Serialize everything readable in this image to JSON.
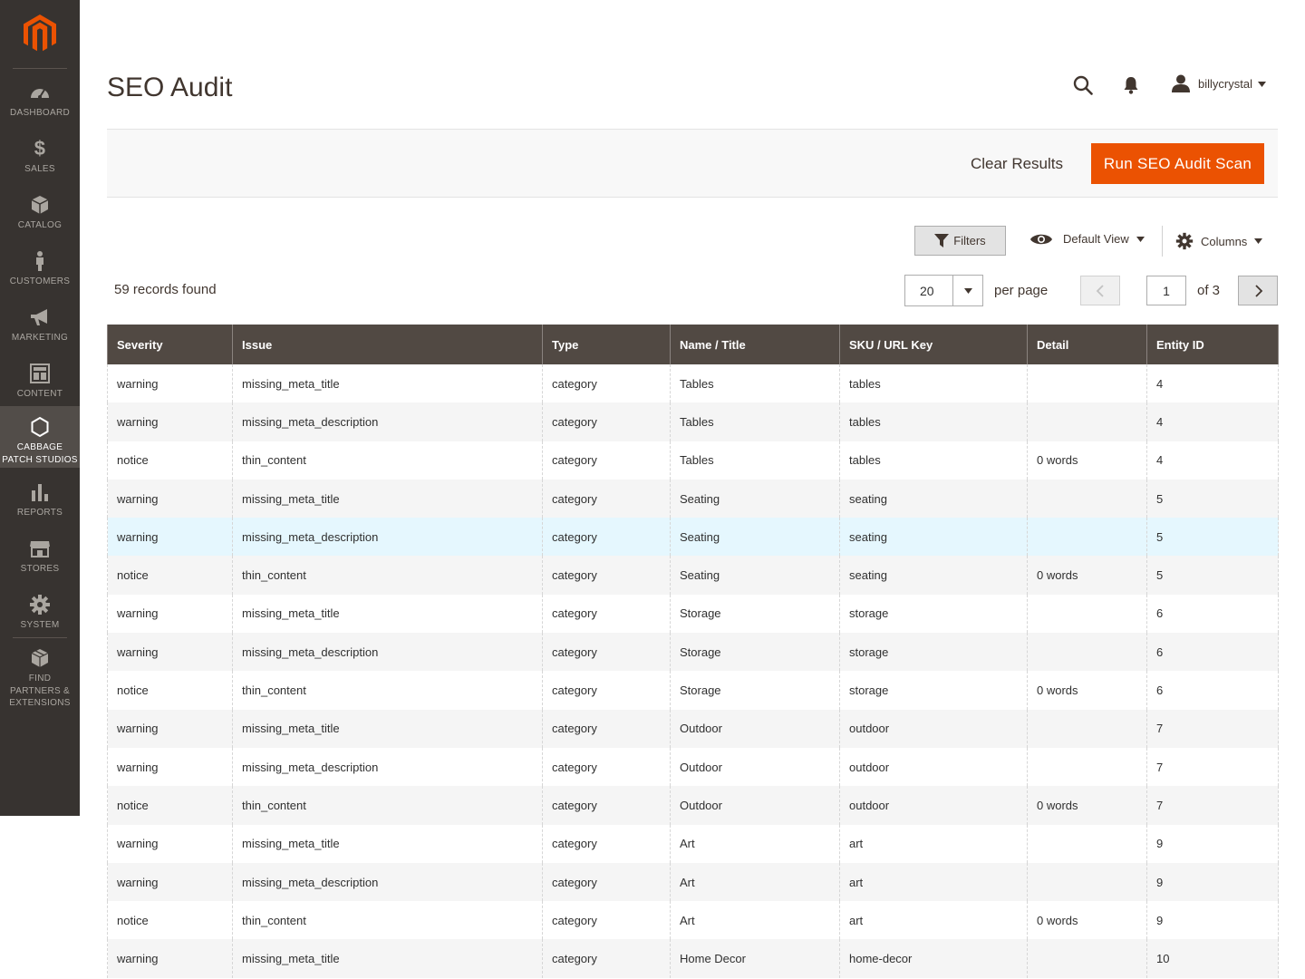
{
  "sidebar": {
    "items": [
      {
        "label": "DASHBOARD",
        "icon": "dashboard-icon"
      },
      {
        "label": "SALES",
        "icon": "dollar-icon"
      },
      {
        "label": "CATALOG",
        "icon": "cube-icon"
      },
      {
        "label": "CUSTOMERS",
        "icon": "person-icon"
      },
      {
        "label": "MARKETING",
        "icon": "megaphone-icon"
      },
      {
        "label": "CONTENT",
        "icon": "layout-icon"
      },
      {
        "label": "CABBAGE PATCH STUDIOS",
        "icon": "hexagon-icon"
      },
      {
        "label": "REPORTS",
        "icon": "bar-chart-icon"
      },
      {
        "label": "STORES",
        "icon": "storefront-icon"
      },
      {
        "label": "SYSTEM",
        "icon": "gear-icon"
      },
      {
        "label": "FIND PARTNERS & EXTENSIONS",
        "icon": "blocks-icon"
      }
    ],
    "active": "CABBAGE PATCH STUDIOS"
  },
  "header": {
    "title": "SEO Audit",
    "user": "billycrystal"
  },
  "actions": {
    "clear": "Clear Results",
    "run": "Run SEO Audit Scan"
  },
  "controls": {
    "filters": "Filters",
    "view": "Default View",
    "columns": "Columns"
  },
  "pagination": {
    "records": "59 records found",
    "per_page_value": "20",
    "per_page_label": "per page",
    "current_page": "1",
    "of": "of 3"
  },
  "colors": {
    "sidebar": "#373330",
    "accent": "#eb5202",
    "table_header": "#514943",
    "row_hover": "#e5f7fe"
  },
  "table": {
    "columns": [
      "Severity",
      "Issue",
      "Type",
      "Name / Title",
      "SKU / URL Key",
      "Detail",
      "Entity ID"
    ],
    "rows": [
      [
        "warning",
        "missing_meta_title",
        "category",
        "Tables",
        "tables",
        "",
        "4"
      ],
      [
        "warning",
        "missing_meta_description",
        "category",
        "Tables",
        "tables",
        "",
        "4"
      ],
      [
        "notice",
        "thin_content",
        "category",
        "Tables",
        "tables",
        "0 words",
        "4"
      ],
      [
        "warning",
        "missing_meta_title",
        "category",
        "Seating",
        "seating",
        "",
        "5"
      ],
      [
        "warning",
        "missing_meta_description",
        "category",
        "Seating",
        "seating",
        "",
        "5"
      ],
      [
        "notice",
        "thin_content",
        "category",
        "Seating",
        "seating",
        "0 words",
        "5"
      ],
      [
        "warning",
        "missing_meta_title",
        "category",
        "Storage",
        "storage",
        "",
        "6"
      ],
      [
        "warning",
        "missing_meta_description",
        "category",
        "Storage",
        "storage",
        "",
        "6"
      ],
      [
        "notice",
        "thin_content",
        "category",
        "Storage",
        "storage",
        "0 words",
        "6"
      ],
      [
        "warning",
        "missing_meta_title",
        "category",
        "Outdoor",
        "outdoor",
        "",
        "7"
      ],
      [
        "warning",
        "missing_meta_description",
        "category",
        "Outdoor",
        "outdoor",
        "",
        "7"
      ],
      [
        "notice",
        "thin_content",
        "category",
        "Outdoor",
        "outdoor",
        "0 words",
        "7"
      ],
      [
        "warning",
        "missing_meta_title",
        "category",
        "Art",
        "art",
        "",
        "9"
      ],
      [
        "warning",
        "missing_meta_description",
        "category",
        "Art",
        "art",
        "",
        "9"
      ],
      [
        "notice",
        "thin_content",
        "category",
        "Art",
        "art",
        "0 words",
        "9"
      ],
      [
        "warning",
        "missing_meta_title",
        "category",
        "Home Decor",
        "home-decor",
        "",
        "10"
      ]
    ],
    "highlighted_row": 4
  }
}
